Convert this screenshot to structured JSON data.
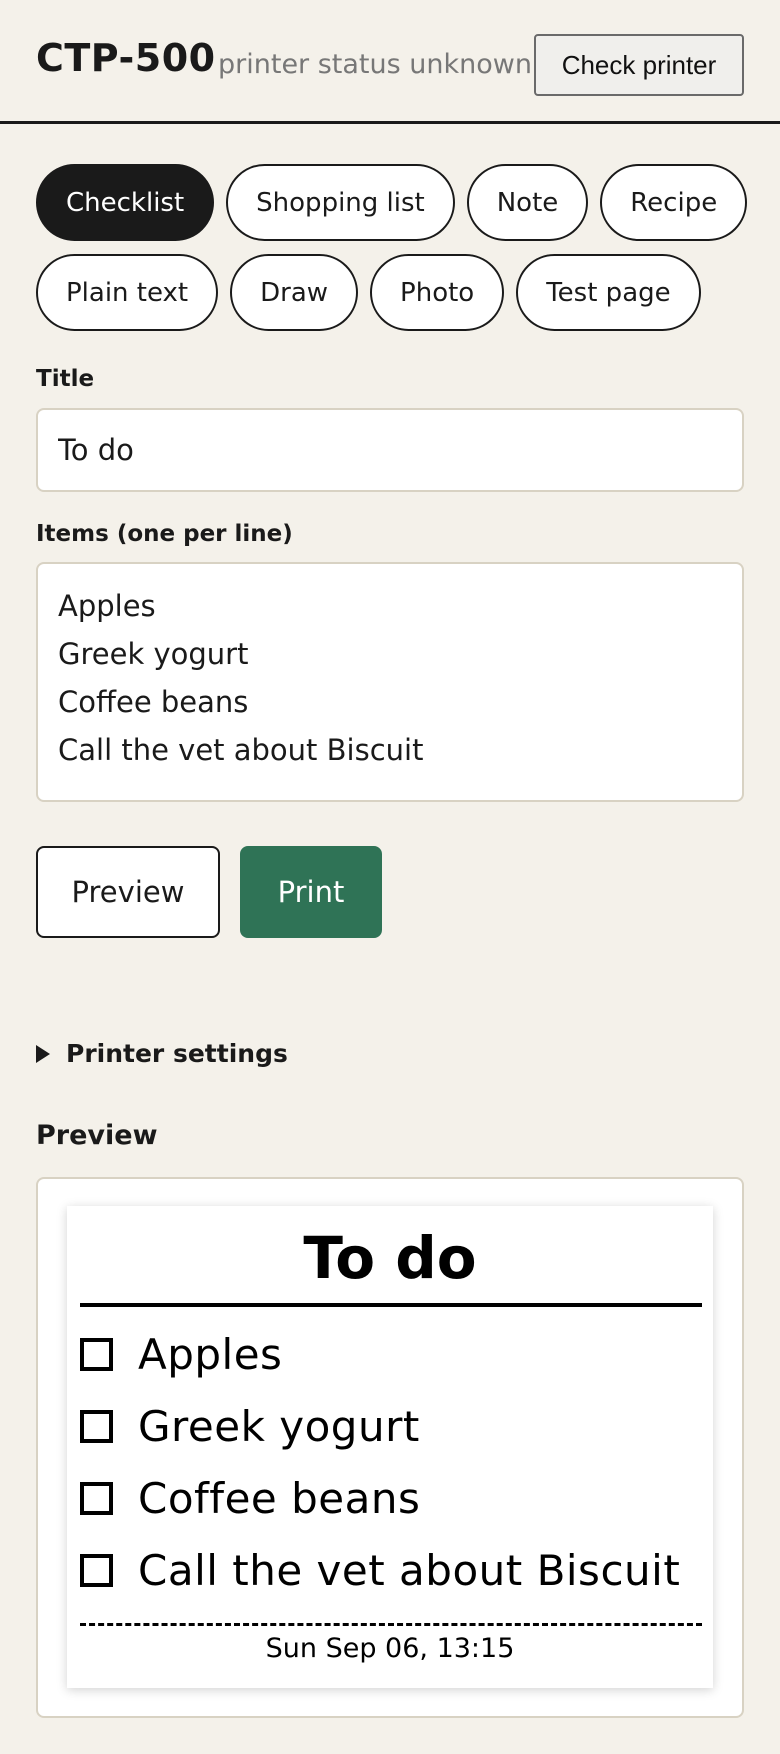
{
  "header": {
    "title": "CTP-500",
    "status": "printer status unknown",
    "check_button": "Check printer"
  },
  "templates": {
    "row1": [
      {
        "label": "Checklist",
        "active": true
      },
      {
        "label": "Shopping list",
        "active": false
      },
      {
        "label": "Note",
        "active": false
      },
      {
        "label": "Recipe",
        "active": false
      }
    ],
    "row2": [
      {
        "label": "Plain text",
        "active": false
      },
      {
        "label": "Draw",
        "active": false
      },
      {
        "label": "Photo",
        "active": false
      },
      {
        "label": "Test page",
        "active": false
      }
    ]
  },
  "form": {
    "title_label": "Title",
    "title_value": "To do",
    "items_label": "Items (one per line)",
    "items": [
      "Apples",
      "Greek yogurt",
      "Coffee beans",
      "Call the vet about Biscuit"
    ]
  },
  "actions": {
    "preview": "Preview",
    "print": "Print"
  },
  "settings": {
    "label": "Printer settings"
  },
  "preview": {
    "heading": "Preview",
    "receipt": {
      "title": "To do",
      "items": [
        "Apples",
        "Greek yogurt",
        "Coffee beans",
        "Call the vet about Biscuit"
      ],
      "date": "Sun Sep 06, 13:15"
    }
  },
  "colors": {
    "background": "#f4f1ea",
    "accent": "#2f7356",
    "active_chip": "#1a1a1a"
  }
}
